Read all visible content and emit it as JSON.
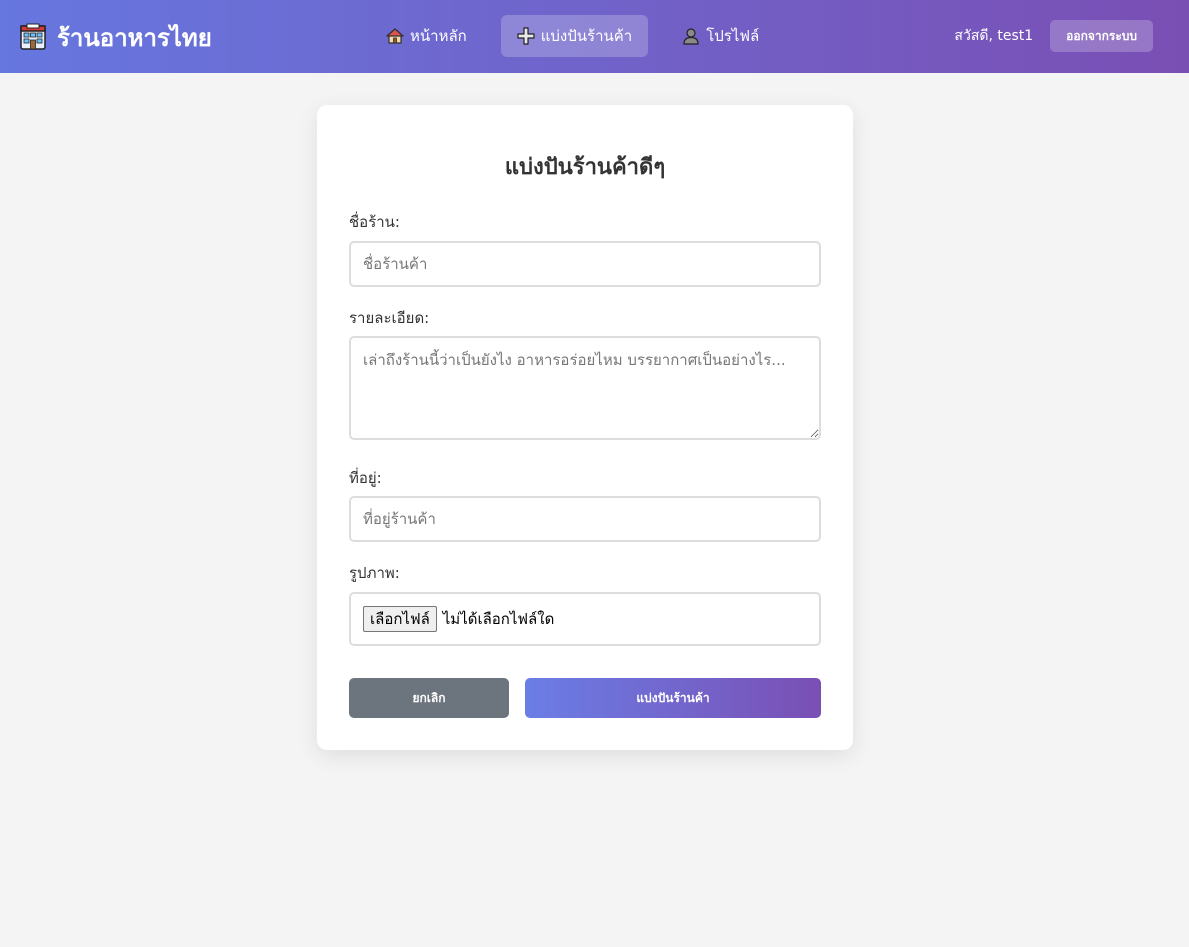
{
  "nav": {
    "brand": {
      "title": "ร้านอาหารไทย",
      "icon": "store-icon"
    },
    "links": [
      {
        "label": "หน้าหลัก",
        "icon": "house-icon",
        "active": false
      },
      {
        "label": "แบ่งปันร้านค้า",
        "icon": "plus-icon",
        "active": true
      },
      {
        "label": "โปรไฟล์",
        "icon": "user-icon",
        "active": false
      }
    ],
    "greeting": "สวัสดี, test1",
    "logout_label": "ออกจากระบบ"
  },
  "form": {
    "title": "แบ่งปันร้านค้าดีๆ",
    "name_label": "ชื่อร้าน:",
    "name_placeholder": "ชื่อร้านค้า",
    "name_value": "",
    "desc_label": "รายละเอียด:",
    "desc_placeholder": "เล่าถึงร้านนี้ว่าเป็นยังไง อาหารอร่อยไหม บรรยากาศเป็นอย่างไร...",
    "desc_value": "",
    "address_label": "ที่อยู่:",
    "address_placeholder": "ที่อยู่ร้านค้า",
    "address_value": "",
    "image_label": "รูปภาพ:",
    "file_button_label": "เลือกไฟล์",
    "file_status": "ไม่ได้เลือกไฟล์ใด",
    "cancel_label": "ยกเลิก",
    "submit_label": "แบ่งปันร้านค้า"
  },
  "colors": {
    "header_gradient_start": "#6677df",
    "header_gradient_end": "#7a4fb4",
    "cancel_button": "#6c757d",
    "page_background": "#f4f4f4"
  }
}
